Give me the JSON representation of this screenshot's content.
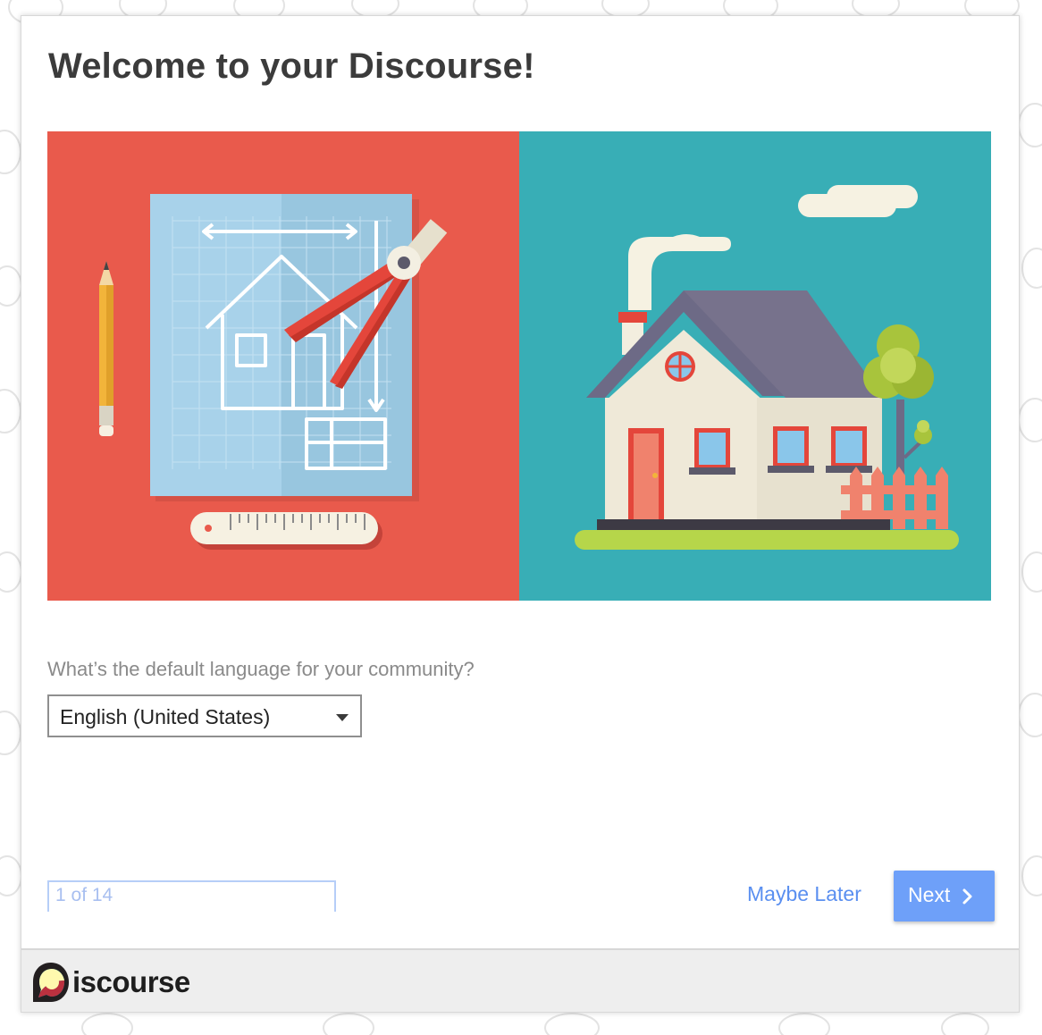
{
  "wizard": {
    "title": "Welcome to your Discourse!",
    "language_question": "What’s the default language for your community?",
    "language_select": {
      "selected": "English (United States)"
    },
    "progress": {
      "text": "1 of 14",
      "current": 1,
      "total": 14
    },
    "maybe_later_label": "Maybe Later",
    "next_label": "Next"
  },
  "footer": {
    "logo_text": "iscourse"
  },
  "colors": {
    "hero_left": "#e95a4c",
    "hero_right": "#38aeb6",
    "accent_blue": "#6ea0f9",
    "link_blue": "#5a8ff0"
  },
  "icons": [
    "chevron-right-icon",
    "dropdown-caret-icon",
    "discourse-logo-icon",
    "chat-bubble-pattern"
  ]
}
